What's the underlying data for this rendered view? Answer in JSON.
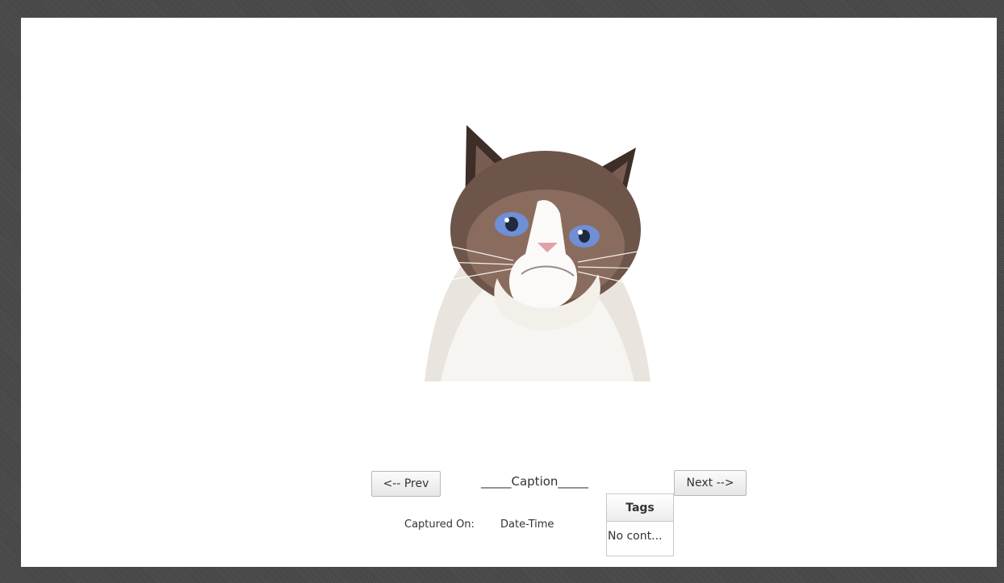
{
  "viewer": {
    "image_icon": "cat-photo",
    "prev_label": "<-- Prev",
    "caption": "_____Caption_____",
    "next_label": "Next -->",
    "captured_label": "Captured On:",
    "captured_value": "Date-Time"
  },
  "tags": {
    "header": "Tags",
    "placeholder": "No cont..."
  },
  "colors": {
    "frame": "#4a4a4a",
    "window": "#ffffff",
    "button_border": "#b8b8b8"
  }
}
